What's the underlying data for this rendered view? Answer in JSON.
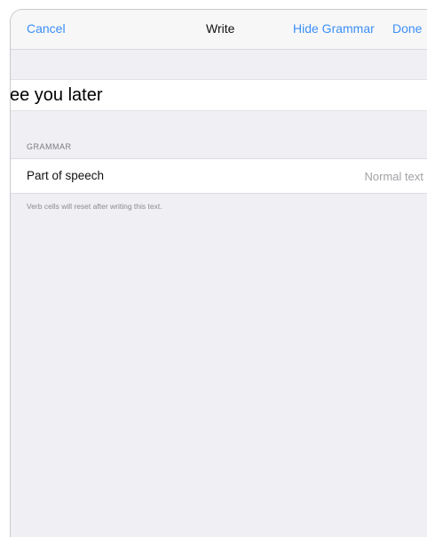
{
  "navbar": {
    "cancel_label": "Cancel",
    "title": "Write",
    "hide_grammar_label": "Hide Grammar",
    "done_label": "Done"
  },
  "text_field": {
    "value": "see you later"
  },
  "grammar": {
    "header": "GRAMMAR",
    "rows": [
      {
        "label": "Part of speech",
        "value": "Normal text"
      }
    ],
    "footer": "Verb cells will reset after writing this text."
  },
  "colors": {
    "accent": "#3b8ff6",
    "background": "#efeff4",
    "secondary_text": "#a2a2a7"
  }
}
